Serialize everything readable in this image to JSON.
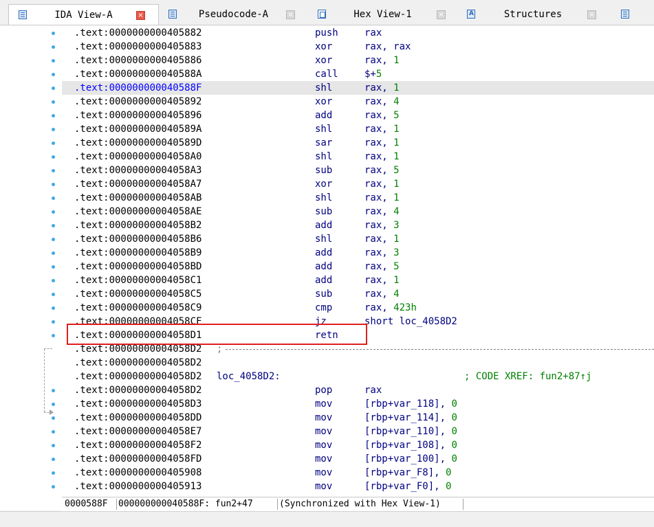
{
  "tabs": [
    {
      "label": "IDA View-A",
      "active": true,
      "icon": "listing-icon"
    },
    {
      "label": "Pseudocode-A",
      "active": false,
      "icon": "listing-icon"
    },
    {
      "label": "Hex View-1",
      "active": false,
      "icon": "hex-icon"
    },
    {
      "label": "Structures",
      "active": false,
      "icon": "structures-icon"
    }
  ],
  "close_glyph": "×",
  "listing": [
    {
      "addr": ".text:0000000000405882",
      "mn": "push",
      "op": "rax"
    },
    {
      "addr": ".text:0000000000405883",
      "mn": "xor",
      "op": "rax, rax"
    },
    {
      "addr": ".text:0000000000405886",
      "mn": "xor",
      "op": "rax, ",
      "num": "1"
    },
    {
      "addr": ".text:000000000040588A",
      "mn": "call",
      "op": "$+",
      "num": "5"
    },
    {
      "addr": ".text:000000000040588F",
      "mn": "shl",
      "op": "rax, ",
      "num": "1"
    },
    {
      "addr": ".text:0000000000405892",
      "mn": "xor",
      "op": "rax, ",
      "num": "4"
    },
    {
      "addr": ".text:0000000000405896",
      "mn": "add",
      "op": "rax, ",
      "num": "5"
    },
    {
      "addr": ".text:000000000040589A",
      "mn": "shl",
      "op": "rax, ",
      "num": "1"
    },
    {
      "addr": ".text:000000000040589D",
      "mn": "sar",
      "op": "rax, ",
      "num": "1"
    },
    {
      "addr": ".text:00000000004058A0",
      "mn": "shl",
      "op": "rax, ",
      "num": "1"
    },
    {
      "addr": ".text:00000000004058A3",
      "mn": "sub",
      "op": "rax, ",
      "num": "5"
    },
    {
      "addr": ".text:00000000004058A7",
      "mn": "xor",
      "op": "rax, ",
      "num": "1"
    },
    {
      "addr": ".text:00000000004058AB",
      "mn": "shl",
      "op": "rax, ",
      "num": "1"
    },
    {
      "addr": ".text:00000000004058AE",
      "mn": "sub",
      "op": "rax, ",
      "num": "4"
    },
    {
      "addr": ".text:00000000004058B2",
      "mn": "add",
      "op": "rax, ",
      "num": "3"
    },
    {
      "addr": ".text:00000000004058B6",
      "mn": "shl",
      "op": "rax, ",
      "num": "1"
    },
    {
      "addr": ".text:00000000004058B9",
      "mn": "add",
      "op": "rax, ",
      "num": "3"
    },
    {
      "addr": ".text:00000000004058BD",
      "mn": "add",
      "op": "rax, ",
      "num": "5"
    },
    {
      "addr": ".text:00000000004058C1",
      "mn": "add",
      "op": "rax, ",
      "num": "1"
    },
    {
      "addr": ".text:00000000004058C5",
      "mn": "sub",
      "op": "rax, ",
      "num": "4"
    },
    {
      "addr": ".text:00000000004058C9",
      "mn": "cmp",
      "op": "rax, ",
      "num": "423h"
    },
    {
      "addr": ".text:00000000004058CF",
      "mn": "jz",
      "op": "short loc_4058D2"
    },
    {
      "addr": ".text:00000000004058D1",
      "mn": "retn",
      "op": ""
    },
    {
      "addr": ".text:00000000004058D2",
      "semi": ";"
    },
    {
      "addr": ".text:00000000004058D2"
    },
    {
      "addr": ".text:00000000004058D2",
      "label": "loc_4058D2:",
      "comment": "; CODE XREF: fun2+87↑j"
    },
    {
      "addr": ".text:00000000004058D2",
      "mn": "pop",
      "op": "rax"
    },
    {
      "addr": ".text:00000000004058D3",
      "mn": "mov",
      "op": "[rbp+var_118], ",
      "num": "0"
    },
    {
      "addr": ".text:00000000004058DD",
      "mn": "mov",
      "op": "[rbp+var_114], ",
      "num": "0"
    },
    {
      "addr": ".text:00000000004058E7",
      "mn": "mov",
      "op": "[rbp+var_110], ",
      "num": "0"
    },
    {
      "addr": ".text:00000000004058F2",
      "mn": "mov",
      "op": "[rbp+var_108], ",
      "num": "0"
    },
    {
      "addr": ".text:00000000004058FD",
      "mn": "mov",
      "op": "[rbp+var_100], ",
      "num": "0"
    },
    {
      "addr": ".text:0000000000405908",
      "mn": "mov",
      "op": "[rbp+var_F8], ",
      "num": "0"
    },
    {
      "addr": ".text:0000000000405913",
      "mn": "mov",
      "op": "[rbp+var_F0], ",
      "num": "0"
    }
  ],
  "selected_row": 4,
  "highlighted_row": 22,
  "status": {
    "offset": "0000588F",
    "location": "000000000040588F: fun2+47",
    "sync": "(Synchronized with Hex View-1)"
  },
  "colors": {
    "selection": "#e6e6e6",
    "highlight_box": "#e01e1e",
    "mnemonic": "#000080",
    "number": "#008000",
    "dot": "#40a8e8"
  }
}
